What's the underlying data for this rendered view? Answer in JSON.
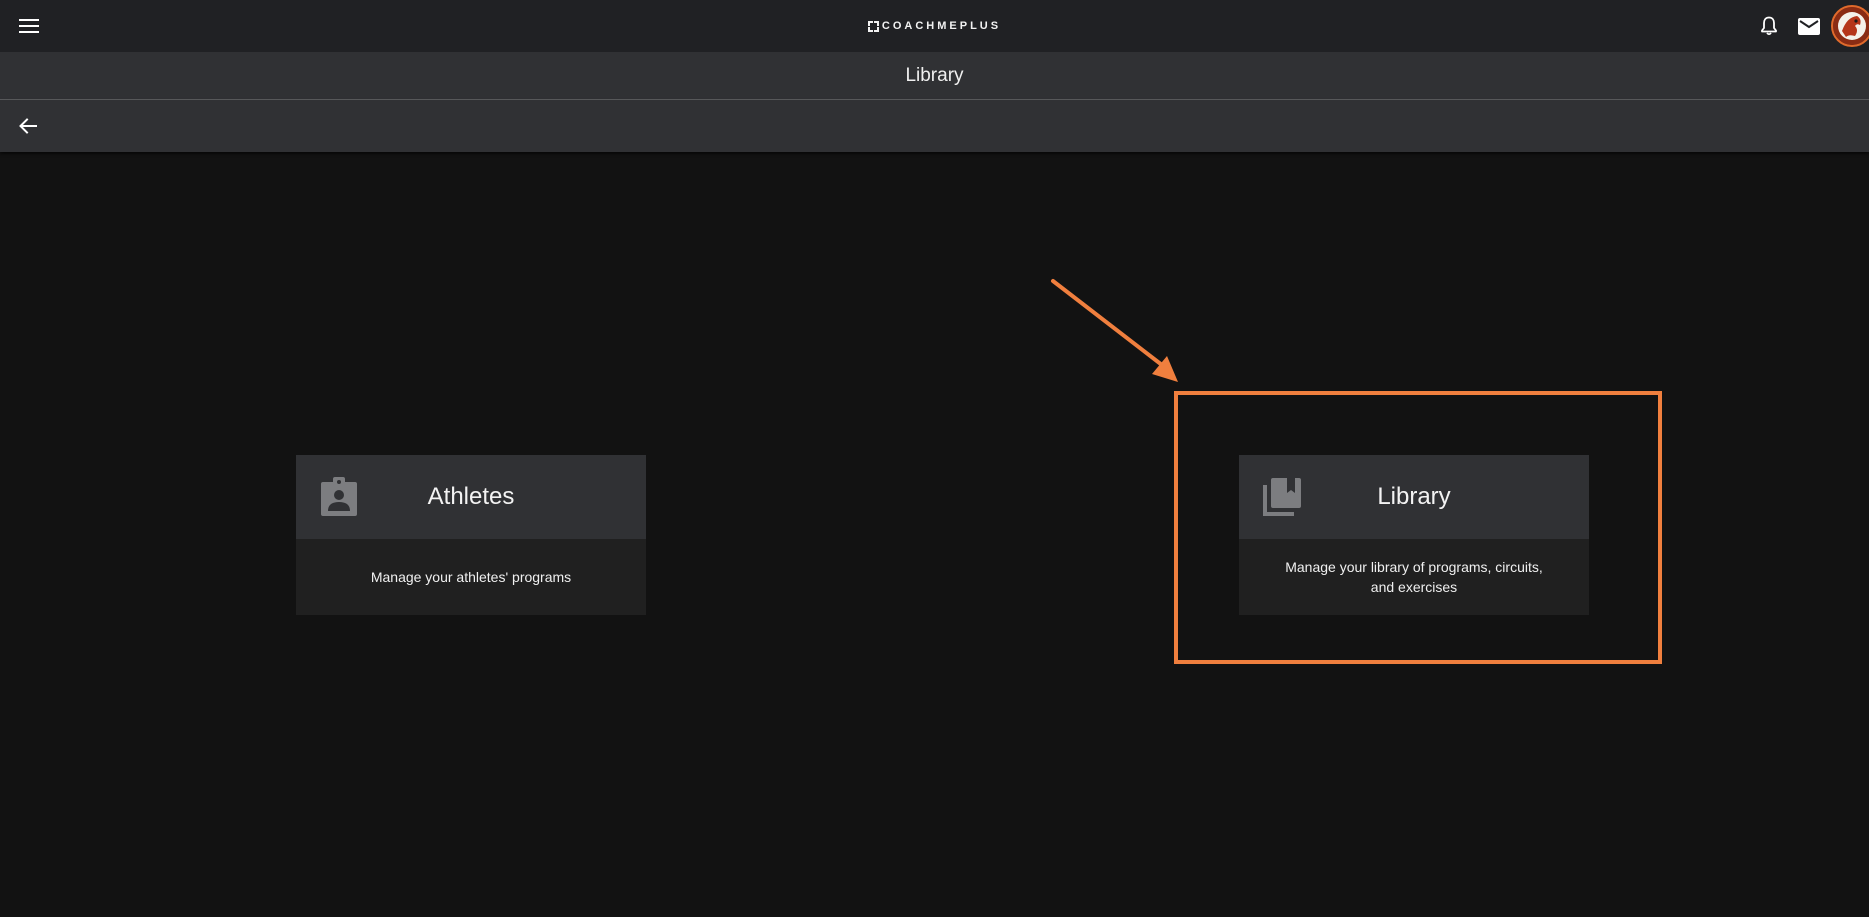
{
  "topbar": {
    "brand": "COACHMEPLUS",
    "menu_icon": "hamburger-menu-icon",
    "notifications_icon": "bell-icon",
    "messages_icon": "mail-icon",
    "avatar_icon": "team-logo-avatar"
  },
  "page": {
    "title": "Library",
    "back_icon": "arrow-left-icon"
  },
  "cards": [
    {
      "title": "Athletes",
      "description": "Manage your athletes' programs",
      "icon": "contact-badge-icon"
    },
    {
      "title": "Library",
      "description": "Manage your library of programs, circuits, and exercises",
      "icon": "library-books-icon"
    }
  ],
  "annotation": {
    "color": "#f07f3e",
    "target": "Library card"
  },
  "colors": {
    "background": "#121212",
    "topbar": "#202124",
    "titlebar": "#303134",
    "card_header": "#303134",
    "card_body": "#202020",
    "accent": "#f07f3e"
  }
}
